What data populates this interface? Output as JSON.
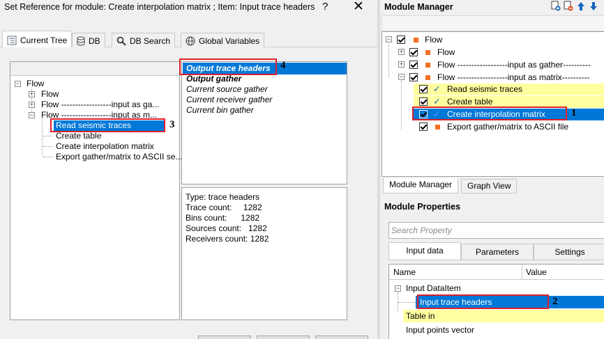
{
  "dialog": {
    "title": "Set Reference for module: Create interpolation matrix ; Item: Input trace headers",
    "help_label": "?",
    "close_label": "✕",
    "tabs": [
      {
        "label": "Current Tree",
        "icon": "tree-icon",
        "active": true
      },
      {
        "label": "DB",
        "icon": "database-icon",
        "active": false
      },
      {
        "label": "DB Search",
        "icon": "search-icon",
        "active": false
      },
      {
        "label": "Global Variables",
        "icon": "globe-icon",
        "active": false
      }
    ],
    "tree": {
      "root": "Flow",
      "children": [
        "Flow",
        "Flow ------------------input as ga...",
        "Flow ------------------input as m..."
      ],
      "modules": [
        "Read seismic traces",
        "Create table",
        "Create interpolation matrix",
        "Export gather/matrix to ASCII se..."
      ]
    },
    "items": [
      "Output trace headers",
      "Output gather",
      "Current source gather",
      "Current receiver gather",
      "Current bin gather"
    ],
    "info": {
      "type": "Type: trace headers",
      "trace_count": "Trace count:     1282",
      "bins_count": "Bins count:      1282",
      "sources_count": "Sources count:   1282",
      "receivers_count": "Receivers count: 1282"
    }
  },
  "module_manager": {
    "title": "Module Manager",
    "tree": {
      "root": "Flow",
      "flows": [
        "Flow",
        "Flow ------------------input as gather----------",
        "Flow ------------------input as matrix----------"
      ],
      "modules": [
        "Read seismic traces",
        "Create table",
        "Create interpolation matrix",
        "Export gather/matrix to ASCII file"
      ]
    },
    "lower_tabs": [
      "Module Manager",
      "Graph View"
    ]
  },
  "module_properties": {
    "title": "Module Properties",
    "search_placeholder": "Search Property",
    "tabs": [
      "Input data",
      "Parameters",
      "Settings"
    ],
    "columns": [
      "Name",
      "Value"
    ],
    "rows": [
      "Input DataItem",
      "Input trace headers",
      "Table in",
      "Input points vector"
    ]
  },
  "markers": [
    "1",
    "2",
    "3",
    "4"
  ],
  "colors": {
    "selection": "#0078d7",
    "highlight_yellow": "#ffffa0",
    "annotation_red": "#e0202a",
    "module_orange": "#f37021"
  }
}
